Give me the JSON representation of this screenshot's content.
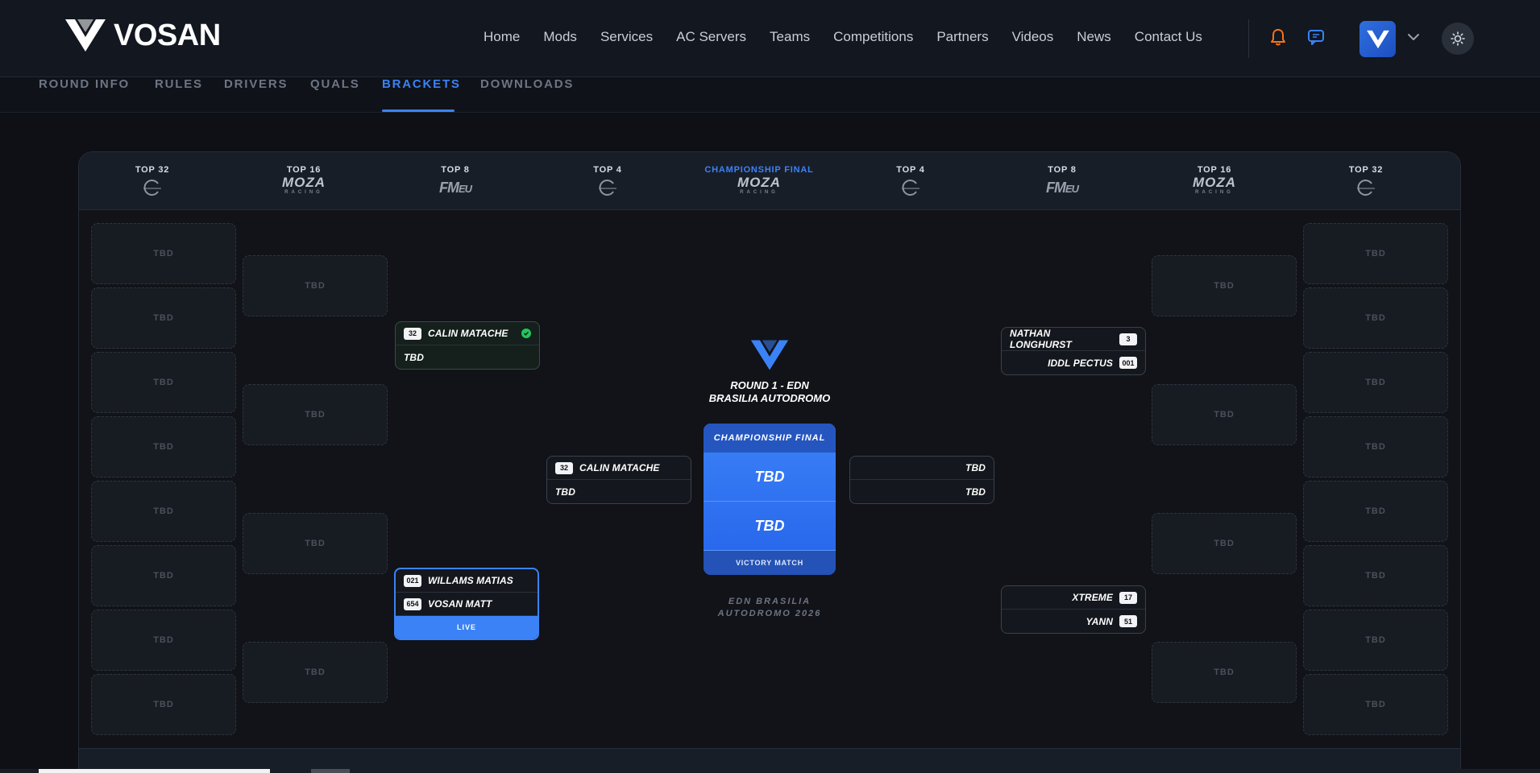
{
  "brand": {
    "name": "VOSAN"
  },
  "nav": {
    "links": [
      "Home",
      "Mods",
      "Services",
      "AC Servers",
      "Teams",
      "Competitions",
      "Partners",
      "Videos",
      "News",
      "Contact Us"
    ]
  },
  "icons": {
    "bell": "bell-icon",
    "chat": "chat-icon",
    "chevron": "chevron-down-icon",
    "theme": "sun-icon"
  },
  "colors": {
    "accent": "#3b82f6",
    "bell": "#f97316",
    "check": "#22c55e"
  },
  "tabs": [
    {
      "label": "ROUND INFO",
      "active": false
    },
    {
      "label": "RULES",
      "active": false
    },
    {
      "label": "DRIVERS",
      "active": false
    },
    {
      "label": "QUALS",
      "active": false
    },
    {
      "label": "BRACKETS",
      "active": true
    },
    {
      "label": "DOWNLOADS",
      "active": false
    }
  ],
  "columns": [
    {
      "title": "TOP 32",
      "sponsor": "ring"
    },
    {
      "title": "TOP 16",
      "sponsor": "MOZA"
    },
    {
      "title": "TOP 8",
      "sponsor": "FM EU"
    },
    {
      "title": "TOP 4",
      "sponsor": "ring"
    },
    {
      "title": "CHAMPIONSHIP FINAL",
      "sponsor": "MOZA"
    },
    {
      "title": "TOP 4",
      "sponsor": "ring"
    },
    {
      "title": "TOP 8",
      "sponsor": "FM EU"
    },
    {
      "title": "TOP 16",
      "sponsor": "MOZA"
    },
    {
      "title": "TOP 32",
      "sponsor": "ring"
    }
  ],
  "sponsor_text": {
    "moza": "MOZA",
    "moza_sub": "RACING",
    "fm": "FM",
    "eu": "EU"
  },
  "tbd": "TBD",
  "matches": {
    "left_top8_a": {
      "p1_seed": "32",
      "p1": "CALIN MATACHE",
      "p1_winner": true,
      "p2": "TBD"
    },
    "left_top8_b": {
      "p1_seed": "021",
      "p1": "WILLAMS MATIAS",
      "p2_seed": "654",
      "p2": "VOSAN MATT",
      "status": "LIVE"
    },
    "left_top4": {
      "p1_seed": "32",
      "p1": "CALIN MATACHE",
      "p2": "TBD"
    },
    "right_top4": {
      "p1": "TBD",
      "p2": "TBD"
    },
    "right_top8_a": {
      "p1": "NATHAN LONGHURST",
      "p1_seed": "3",
      "p2": "IDDL PECTUS",
      "p2_seed": "001"
    },
    "right_top8_b": {
      "p1": "XTREME",
      "p1_seed": "17",
      "p2": "YANN",
      "p2_seed": "51"
    }
  },
  "round": {
    "line1": "ROUND 1 - EDN",
    "line2": "BRASILIA AUTODROMO"
  },
  "final": {
    "header": "CHAMPIONSHIP FINAL",
    "team1": "TBD",
    "team2": "TBD",
    "footer": "VICTORY MATCH"
  },
  "venue": {
    "line1": "EDN BRASILIA",
    "line2": "AUTODROMO 2026"
  }
}
